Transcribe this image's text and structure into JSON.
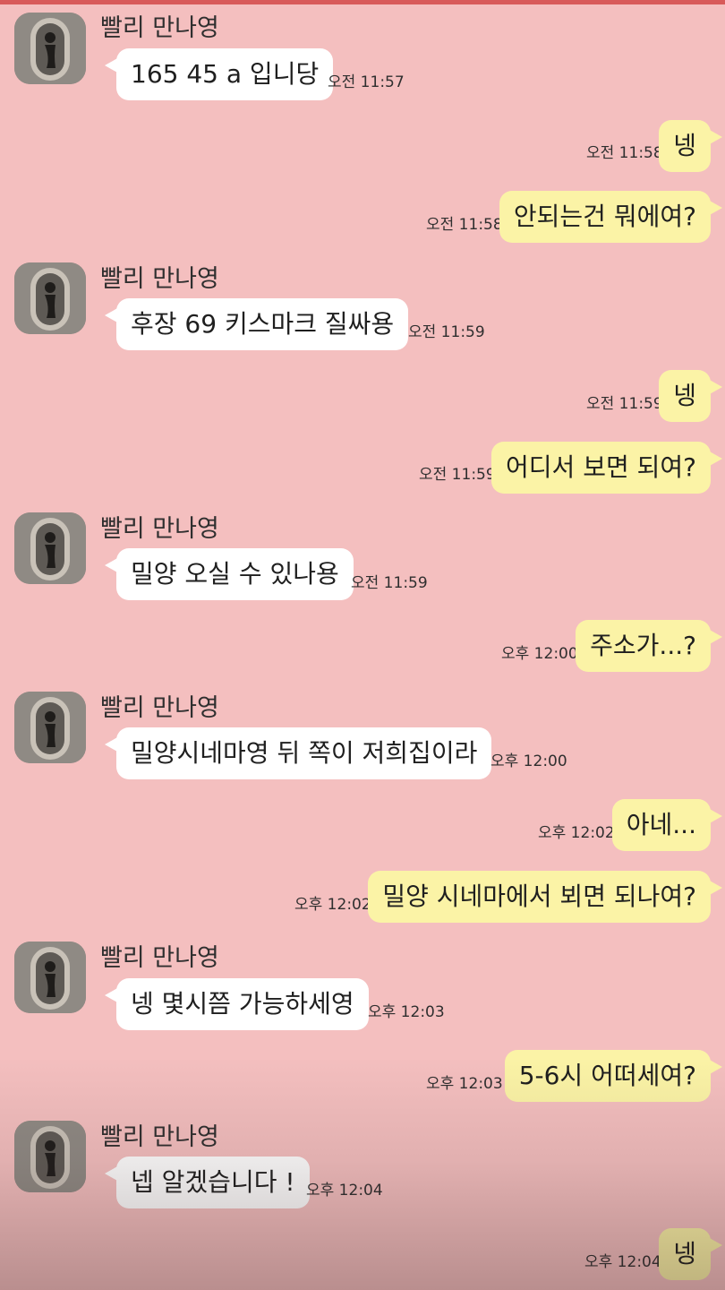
{
  "contact": {
    "name": "빨리 만나영"
  },
  "messages": [
    {
      "from": "them",
      "text": "165 45 a 입니당",
      "time": "오전 11:57"
    },
    {
      "from": "me",
      "text": "넹",
      "time": "오전 11:58"
    },
    {
      "from": "me",
      "text": "안되는건 뭐에여?",
      "time": "오전 11:58"
    },
    {
      "from": "them",
      "text": "후장 69 키스마크 질싸용",
      "time": "오전 11:59"
    },
    {
      "from": "me",
      "text": "넹",
      "time": "오전 11:59"
    },
    {
      "from": "me",
      "text": "어디서 보면 되여?",
      "time": "오전 11:59"
    },
    {
      "from": "them",
      "text": "밀양 오실 수 있나용",
      "time": "오전 11:59"
    },
    {
      "from": "me",
      "text": "주소가...?",
      "time": "오후 12:00"
    },
    {
      "from": "them",
      "text": "밀양시네마영 뒤 쪽이 저희집이라",
      "time": "오후 12:00"
    },
    {
      "from": "me",
      "text": "아네...",
      "time": "오후 12:02"
    },
    {
      "from": "me",
      "text": "밀양 시네마에서 뵈면 되나여?",
      "time": "오후 12:02"
    },
    {
      "from": "them",
      "text": "넹 몇시쯤 가능하세영",
      "time": "오후 12:03"
    },
    {
      "from": "me",
      "text": "5-6시 어떠세여?",
      "time": "오후 12:03"
    },
    {
      "from": "them",
      "text": "넵 알겠습니다 !",
      "time": "오후 12:04"
    },
    {
      "from": "me",
      "text": "넹",
      "time": "오후 12:04"
    }
  ],
  "colors": {
    "background": "#f4bfbf",
    "incoming_bubble": "#ffffff",
    "outgoing_bubble": "#fbf3a6"
  },
  "icons": {
    "avatar": "profile-photo"
  }
}
